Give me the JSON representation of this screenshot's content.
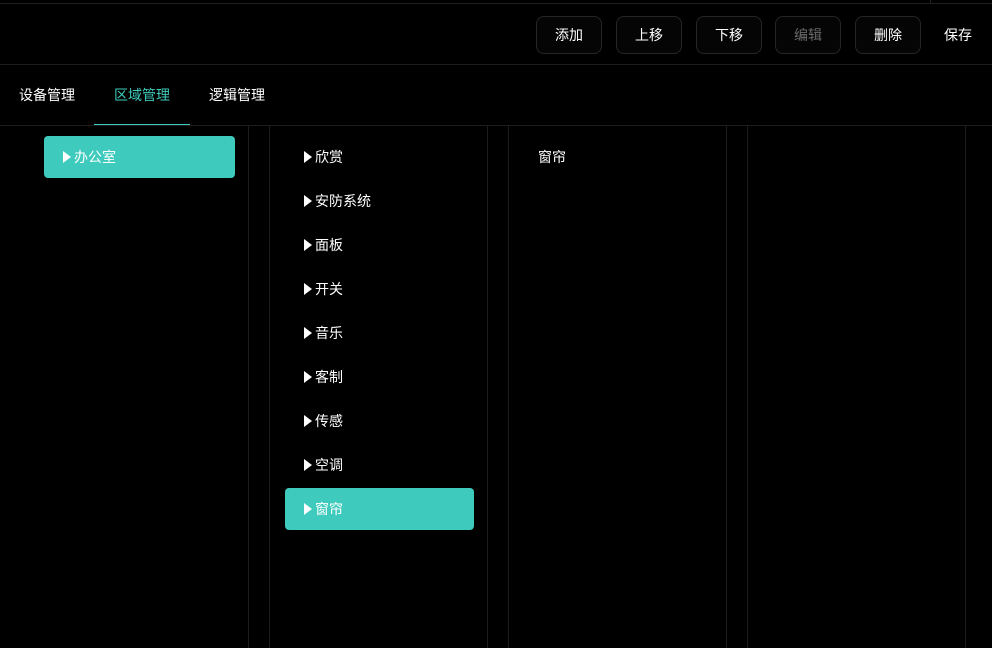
{
  "toolbar": {
    "add": "添加",
    "move_up": "上移",
    "move_down": "下移",
    "edit": "编辑",
    "delete": "删除",
    "save": "保存"
  },
  "tabs": [
    "设备管理",
    "区域管理",
    "逻辑管理"
  ],
  "active_tab": "区域管理",
  "column1": [
    "办公室"
  ],
  "column2": [
    "欣赏",
    "安防系统",
    "面板",
    "开关",
    "音乐",
    "客制",
    "传感",
    "空调",
    "窗帘"
  ],
  "column3": [
    "窗帘"
  ],
  "colors": {
    "accent": "#3ecbbd",
    "background": "#000000",
    "text": "#ffffff",
    "disabled_text": "#6a6a6a"
  },
  "icons": {
    "expand": "caret-right-icon"
  }
}
